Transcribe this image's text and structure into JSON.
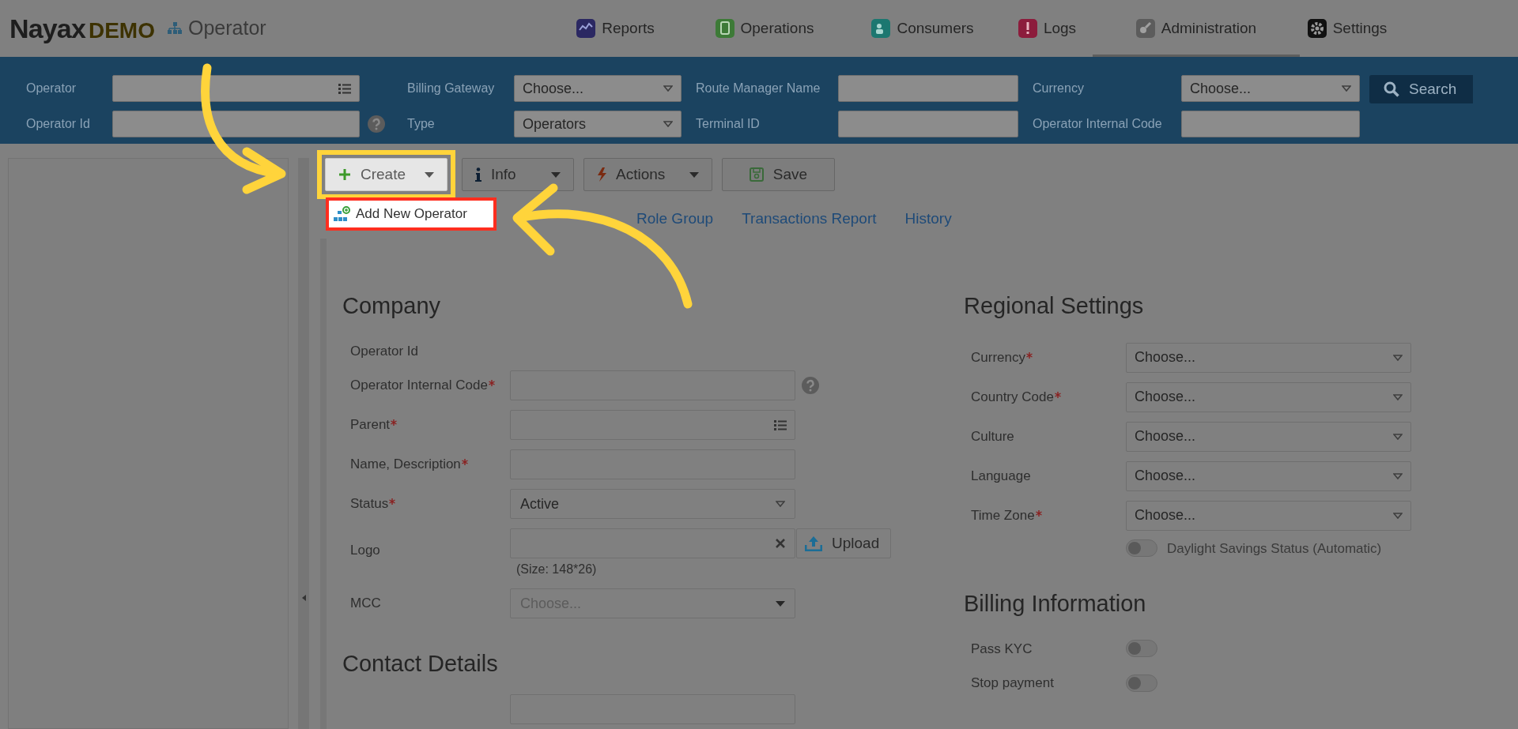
{
  "header": {
    "logo": "Nayax",
    "logo_suffix": "DEMO",
    "module": "Operator",
    "nav": [
      {
        "label": "Reports",
        "kind": "chart",
        "color": "#2b2862",
        "selected": false
      },
      {
        "label": "Operations",
        "kind": "device",
        "color": "#3d7a37",
        "selected": false
      },
      {
        "label": "Consumers",
        "kind": "people",
        "color": "#1c7770",
        "selected": false
      },
      {
        "label": "Logs",
        "kind": "alert",
        "color": "#8c1c3c",
        "selected": false
      },
      {
        "label": "Administration",
        "kind": "key",
        "color": "#5c5c5c",
        "selected": true
      },
      {
        "label": "Settings",
        "kind": "gear",
        "color": "#111111",
        "selected": false
      }
    ]
  },
  "filters": {
    "columns": [
      [
        {
          "label": "Operator",
          "kind": "lookup"
        },
        {
          "label": "Operator Id",
          "kind": "text",
          "help": true
        }
      ],
      [
        {
          "label": "Billing Gateway",
          "kind": "select",
          "value": "Choose..."
        },
        {
          "label": "Type",
          "kind": "select",
          "value": "Operators"
        }
      ],
      [
        {
          "label": "Route Manager Name",
          "kind": "text"
        },
        {
          "label": "Terminal ID",
          "kind": "text"
        }
      ],
      [
        {
          "label": "Currency",
          "kind": "select",
          "value": "Choose..."
        },
        {
          "label": "Operator Internal Code",
          "kind": "text"
        }
      ]
    ],
    "search_button": "Search"
  },
  "toolbar": [
    {
      "label": "Create",
      "split": true,
      "highlighted": true
    },
    {
      "label": "Info",
      "split": true,
      "highlighted": false
    },
    {
      "label": "Actions",
      "split": true,
      "highlighted": false
    },
    {
      "label": "Save",
      "split": false,
      "highlighted": false
    }
  ],
  "create_menu": {
    "items": [
      {
        "label": "Add New Operator"
      }
    ]
  },
  "tabs": [
    {
      "label": "Role Group",
      "selected": false
    },
    {
      "label": "Transactions Report",
      "selected": false
    },
    {
      "label": "History",
      "selected": false
    }
  ],
  "company": {
    "title": "Company",
    "rows": [
      {
        "kind": "static",
        "label": "Operator Id",
        "required": false
      },
      {
        "kind": "text",
        "label": "Operator Internal Code",
        "required": true,
        "help": true
      },
      {
        "kind": "lookup",
        "label": "Parent",
        "required": true
      },
      {
        "kind": "text",
        "label": "Name, Description",
        "required": true
      },
      {
        "kind": "select",
        "label": "Status",
        "required": true,
        "value": "Active"
      },
      {
        "kind": "file",
        "label": "Logo",
        "required": false,
        "button": "Upload",
        "note": "(Size: 148*26)"
      },
      {
        "kind": "select",
        "label": "MCC",
        "required": false,
        "placeholder": "Choose...",
        "disabled": true
      }
    ]
  },
  "contact": {
    "title": "Contact Details"
  },
  "regional": {
    "title": "Regional Settings",
    "rows": [
      {
        "kind": "select",
        "label": "Currency",
        "required": true,
        "value": "Choose..."
      },
      {
        "kind": "select",
        "label": "Country Code",
        "required": true,
        "value": "Choose..."
      },
      {
        "kind": "select",
        "label": "Culture",
        "required": false,
        "value": "Choose..."
      },
      {
        "kind": "select",
        "label": "Language",
        "required": false,
        "value": "Choose..."
      },
      {
        "kind": "select",
        "label": "Time Zone",
        "required": true,
        "value": "Choose..."
      },
      {
        "kind": "toggle",
        "label": "Daylight Savings Status (Automatic)",
        "on": false
      }
    ]
  },
  "billing": {
    "title": "Billing Information",
    "rows": [
      {
        "label": "Pass KYC",
        "on": false
      },
      {
        "label": "Stop payment",
        "on": false
      }
    ]
  }
}
